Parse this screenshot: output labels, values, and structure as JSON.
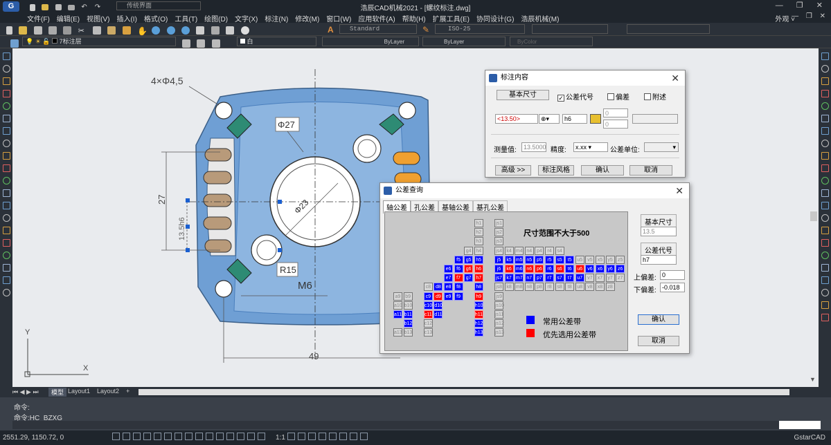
{
  "titlebar": {
    "app_title": "浩辰CAD机械2021 - [螺纹标注.dwg]",
    "workspace": "传统界面",
    "appearance": "外观"
  },
  "menu": [
    "文件(F)",
    "编辑(E)",
    "视图(V)",
    "插入(I)",
    "格式(O)",
    "工具(T)",
    "绘图(D)",
    "文字(X)",
    "标注(N)",
    "修改(M)",
    "窗口(W)",
    "应用软件(A)",
    "帮助(H)",
    "扩展工具(E)",
    "协同设计(G)",
    "浩辰机械(M)"
  ],
  "toolbar1": {
    "text_style": "Standard",
    "dim_style": "ISO-25"
  },
  "toolbar2": {
    "layer": "7标注层",
    "color": "白",
    "linetype": "ByLayer",
    "lineweight": "ByLayer",
    "plotstyle": "ByColor"
  },
  "drawing": {
    "hole_note": "4×Φ4,5",
    "dia27": "Φ27",
    "dia23": "Φ23",
    "r15": "R15",
    "m6": "M6",
    "dim27": "27",
    "dim13": "13.5h6",
    "dim49": "49"
  },
  "colors": {
    "part_fill": "#6f9fd4",
    "part_dark": "#4a7fbd",
    "accent_green": "#2e8b74",
    "accent_orange": "#f0a030",
    "tan": "#b89a7a"
  },
  "tabs": {
    "model": "模型",
    "layout1": "Layout1",
    "layout2": "Layout2",
    "plus": "+"
  },
  "command": {
    "line1": "命令:",
    "line2": "命令:HC_BZXG"
  },
  "status": {
    "coords": "2551.29, 1150.72, 0",
    "scale": "1:1",
    "brand": "GstarCAD"
  },
  "dim_dialog": {
    "title": "标注内容",
    "base_dim_label": "基本尺寸",
    "tol_code_label": "公差代号",
    "tol_code_checked": true,
    "deviation_label": "偏差",
    "attach_label": "附述",
    "value_text": "<13.50>",
    "code_value": "h6",
    "dev_upper": "0",
    "dev_lower": "0",
    "measure_label": "测量值:",
    "measure_value": "13.5000",
    "precision_label": "精度:",
    "precision_value": "x.xx",
    "unit_label": "公差单位:",
    "btn_advanced": "高级 >>",
    "btn_style": "标注风格",
    "btn_ok": "确认",
    "btn_cancel": "取消"
  },
  "tol_dialog": {
    "title": "公差查询",
    "tabs": [
      "轴公差",
      "孔公差",
      "基轴公差",
      "基孔公差"
    ],
    "range_text": "尺寸范围不大于500",
    "legend_common": "常用公差带",
    "legend_preferred": "优先选用公差带",
    "legend_common_color": "#0000ff",
    "legend_preferred_color": "#ff0000",
    "base_size_label": "基本尺寸",
    "base_size_value": "13.5",
    "code_label": "公差代号",
    "code_value": "h7",
    "upper_label": "上偏差:",
    "upper_value": "0",
    "lower_label": "下偏差:",
    "lower_value": "-0.018",
    "btn_ok": "确认",
    "btn_cancel": "取消",
    "cells": [
      {
        "t": "h1",
        "s": "w",
        "c": 8,
        "r": 0
      },
      {
        "t": "js1",
        "s": "w",
        "c": 10,
        "r": 0
      },
      {
        "t": "h2",
        "s": "w",
        "c": 8,
        "r": 1
      },
      {
        "t": "js2",
        "s": "w",
        "c": 10,
        "r": 1
      },
      {
        "t": "h3",
        "s": "w",
        "c": 8,
        "r": 2
      },
      {
        "t": "js3",
        "s": "w",
        "c": 10,
        "r": 2
      },
      {
        "t": "g4",
        "s": "w",
        "c": 7,
        "r": 3
      },
      {
        "t": "h4",
        "s": "w",
        "c": 8,
        "r": 3
      },
      {
        "t": "js4",
        "s": "w",
        "c": 10,
        "r": 3
      },
      {
        "t": "k4",
        "s": "w",
        "c": 11,
        "r": 3
      },
      {
        "t": "m4",
        "s": "w",
        "c": 12,
        "r": 3
      },
      {
        "t": "n4",
        "s": "w",
        "c": 13,
        "r": 3
      },
      {
        "t": "p4",
        "s": "w",
        "c": 14,
        "r": 3
      },
      {
        "t": "r4",
        "s": "w",
        "c": 15,
        "r": 3
      },
      {
        "t": "s4",
        "s": "w",
        "c": 16,
        "r": 3
      },
      {
        "t": "f5",
        "s": "b",
        "c": 6,
        "r": 4
      },
      {
        "t": "g5",
        "s": "b",
        "c": 7,
        "r": 4
      },
      {
        "t": "h5",
        "s": "b",
        "c": 8,
        "r": 4
      },
      {
        "t": "j5",
        "s": "b",
        "c": 10,
        "r": 4
      },
      {
        "t": "k5",
        "s": "b",
        "c": 11,
        "r": 4
      },
      {
        "t": "m5",
        "s": "b",
        "c": 12,
        "r": 4
      },
      {
        "t": "n5",
        "s": "b",
        "c": 13,
        "r": 4
      },
      {
        "t": "p5",
        "s": "b",
        "c": 14,
        "r": 4
      },
      {
        "t": "r5",
        "s": "b",
        "c": 15,
        "r": 4
      },
      {
        "t": "s5",
        "s": "b",
        "c": 16,
        "r": 4
      },
      {
        "t": "t5",
        "s": "b",
        "c": 17,
        "r": 4
      },
      {
        "t": "u5",
        "s": "w",
        "c": 18,
        "r": 4
      },
      {
        "t": "v5",
        "s": "w",
        "c": 19,
        "r": 4
      },
      {
        "t": "x5",
        "s": "w",
        "c": 20,
        "r": 4
      },
      {
        "t": "y5",
        "s": "w",
        "c": 21,
        "r": 4
      },
      {
        "t": "z5",
        "s": "w",
        "c": 22,
        "r": 4
      },
      {
        "t": "e6",
        "s": "b",
        "c": 5,
        "r": 5
      },
      {
        "t": "f6",
        "s": "b",
        "c": 6,
        "r": 5
      },
      {
        "t": "g6",
        "s": "r",
        "c": 7,
        "r": 5
      },
      {
        "t": "h6",
        "s": "r",
        "c": 8,
        "r": 5
      },
      {
        "t": "j6",
        "s": "b",
        "c": 10,
        "r": 5
      },
      {
        "t": "k6",
        "s": "r",
        "c": 11,
        "r": 5
      },
      {
        "t": "m6",
        "s": "b",
        "c": 12,
        "r": 5
      },
      {
        "t": "n6",
        "s": "r",
        "c": 13,
        "r": 5
      },
      {
        "t": "p6",
        "s": "r",
        "c": 14,
        "r": 5
      },
      {
        "t": "r6",
        "s": "b",
        "c": 15,
        "r": 5
      },
      {
        "t": "s6",
        "s": "r",
        "c": 16,
        "r": 5
      },
      {
        "t": "t6",
        "s": "b",
        "c": 17,
        "r": 5
      },
      {
        "t": "u6",
        "s": "r",
        "c": 18,
        "r": 5
      },
      {
        "t": "v6",
        "s": "b",
        "c": 19,
        "r": 5
      },
      {
        "t": "x6",
        "s": "b",
        "c": 20,
        "r": 5
      },
      {
        "t": "y6",
        "s": "b",
        "c": 21,
        "r": 5
      },
      {
        "t": "z6",
        "s": "b",
        "c": 22,
        "r": 5
      },
      {
        "t": "e7",
        "s": "b",
        "c": 5,
        "r": 6
      },
      {
        "t": "f7",
        "s": "r",
        "c": 6,
        "r": 6
      },
      {
        "t": "g7",
        "s": "b",
        "c": 7,
        "r": 6
      },
      {
        "t": "h7",
        "s": "r",
        "c": 8,
        "r": 6
      },
      {
        "t": "js7",
        "s": "b",
        "c": 10,
        "r": 6
      },
      {
        "t": "k7",
        "s": "b",
        "c": 11,
        "r": 6
      },
      {
        "t": "m7",
        "s": "b",
        "c": 12,
        "r": 6
      },
      {
        "t": "n7",
        "s": "b",
        "c": 13,
        "r": 6
      },
      {
        "t": "p7",
        "s": "b",
        "c": 14,
        "r": 6
      },
      {
        "t": "r7",
        "s": "b",
        "c": 15,
        "r": 6
      },
      {
        "t": "s7",
        "s": "b",
        "c": 16,
        "r": 6
      },
      {
        "t": "t7",
        "s": "b",
        "c": 17,
        "r": 6
      },
      {
        "t": "u7",
        "s": "b",
        "c": 18,
        "r": 6
      },
      {
        "t": "v7",
        "s": "w",
        "c": 19,
        "r": 6
      },
      {
        "t": "x7",
        "s": "w",
        "c": 20,
        "r": 6
      },
      {
        "t": "y7",
        "s": "w",
        "c": 21,
        "r": 6
      },
      {
        "t": "z7",
        "s": "w",
        "c": 22,
        "r": 6
      },
      {
        "t": "c8",
        "s": "w",
        "c": 3,
        "r": 7
      },
      {
        "t": "d8",
        "s": "b",
        "c": 4,
        "r": 7
      },
      {
        "t": "e8",
        "s": "b",
        "c": 5,
        "r": 7
      },
      {
        "t": "f8",
        "s": "b",
        "c": 6,
        "r": 7
      },
      {
        "t": "h8",
        "s": "b",
        "c": 8,
        "r": 7
      },
      {
        "t": "js8",
        "s": "w",
        "c": 10,
        "r": 7
      },
      {
        "t": "k8",
        "s": "w",
        "c": 11,
        "r": 7
      },
      {
        "t": "m8",
        "s": "w",
        "c": 12,
        "r": 7
      },
      {
        "t": "n8",
        "s": "w",
        "c": 13,
        "r": 7
      },
      {
        "t": "p8",
        "s": "w",
        "c": 14,
        "r": 7
      },
      {
        "t": "r8",
        "s": "w",
        "c": 15,
        "r": 7
      },
      {
        "t": "s8",
        "s": "w",
        "c": 16,
        "r": 7
      },
      {
        "t": "t8",
        "s": "w",
        "c": 17,
        "r": 7
      },
      {
        "t": "u8",
        "s": "w",
        "c": 18,
        "r": 7
      },
      {
        "t": "v8",
        "s": "w",
        "c": 19,
        "r": 7
      },
      {
        "t": "x8",
        "s": "w",
        "c": 20,
        "r": 7
      },
      {
        "t": "z8",
        "s": "w",
        "c": 21,
        "r": 7
      },
      {
        "t": "a9",
        "s": "w",
        "c": 0,
        "r": 8
      },
      {
        "t": "b9",
        "s": "w",
        "c": 1,
        "r": 8
      },
      {
        "t": "c9",
        "s": "b",
        "c": 3,
        "r": 8
      },
      {
        "t": "d9",
        "s": "r",
        "c": 4,
        "r": 8
      },
      {
        "t": "e9",
        "s": "b",
        "c": 5,
        "r": 8
      },
      {
        "t": "f9",
        "s": "b",
        "c": 6,
        "r": 8
      },
      {
        "t": "h9",
        "s": "r",
        "c": 8,
        "r": 8
      },
      {
        "t": "js9",
        "s": "w",
        "c": 10,
        "r": 8
      },
      {
        "t": "a10",
        "s": "w",
        "c": 0,
        "r": 9
      },
      {
        "t": "b10",
        "s": "w",
        "c": 1,
        "r": 9
      },
      {
        "t": "c10",
        "s": "b",
        "c": 3,
        "r": 9
      },
      {
        "t": "d10",
        "s": "b",
        "c": 4,
        "r": 9
      },
      {
        "t": "h10",
        "s": "b",
        "c": 8,
        "r": 9
      },
      {
        "t": "js10",
        "s": "w",
        "c": 10,
        "r": 9
      },
      {
        "t": "a11",
        "s": "b",
        "c": 0,
        "r": 10
      },
      {
        "t": "b11",
        "s": "b",
        "c": 1,
        "r": 10
      },
      {
        "t": "c11",
        "s": "r",
        "c": 3,
        "r": 10
      },
      {
        "t": "d11",
        "s": "b",
        "c": 4,
        "r": 10
      },
      {
        "t": "h11",
        "s": "r",
        "c": 8,
        "r": 10
      },
      {
        "t": "js11",
        "s": "w",
        "c": 10,
        "r": 10
      },
      {
        "t": "b12",
        "s": "b",
        "c": 1,
        "r": 11
      },
      {
        "t": "c12",
        "s": "w",
        "c": 3,
        "r": 11
      },
      {
        "t": "h12",
        "s": "b",
        "c": 8,
        "r": 11
      },
      {
        "t": "js12",
        "s": "w",
        "c": 10,
        "r": 11
      },
      {
        "t": "a13",
        "s": "w",
        "c": 0,
        "r": 12
      },
      {
        "t": "b13",
        "s": "w",
        "c": 1,
        "r": 12
      },
      {
        "t": "c13",
        "s": "w",
        "c": 3,
        "r": 12
      },
      {
        "t": "h13",
        "s": "b",
        "c": 8,
        "r": 12
      },
      {
        "t": "js13",
        "s": "w",
        "c": 10,
        "r": 12
      }
    ]
  }
}
